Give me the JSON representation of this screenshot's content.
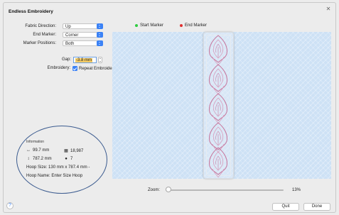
{
  "window": {
    "title": "Endless Embroidery",
    "close_glyph": "✕"
  },
  "form": {
    "fabric_direction": {
      "label": "Fabric Direction:",
      "value": "Up"
    },
    "end_marker": {
      "label": "End Marker:",
      "value": "Corner"
    },
    "marker_positions": {
      "label": "Marker Positions:",
      "value": "Both"
    },
    "gap": {
      "label": "Gap:",
      "value": "-3.8 mm"
    },
    "embroidery": {
      "label": "Embroidery:",
      "checkbox_label": "Repeat Embroidery",
      "checked": true
    }
  },
  "legend": {
    "start": {
      "label": "Start Marker",
      "color": "#2ecc40"
    },
    "end": {
      "label": "End Marker",
      "color": "#e03030"
    }
  },
  "info": {
    "heading": "Information",
    "width": "99.7 mm",
    "height": "787.2 mm",
    "stitches": "18,987",
    "colors": "7",
    "hoop_size": "Hoop Size: 130 mm x 787.4 mm -",
    "hoop_name": "Hoop Name: Enter Size Hoop"
  },
  "zoom": {
    "label": "Zoom:",
    "value": "13%",
    "level": 0.13
  },
  "buttons": {
    "quit": "Quit",
    "done": "Done",
    "help": "?"
  },
  "icons": {
    "width": "arrow-horizontal-icon",
    "height": "arrow-vertical-icon",
    "stitches": "stitch-count-icon",
    "colors": "palette-icon"
  }
}
